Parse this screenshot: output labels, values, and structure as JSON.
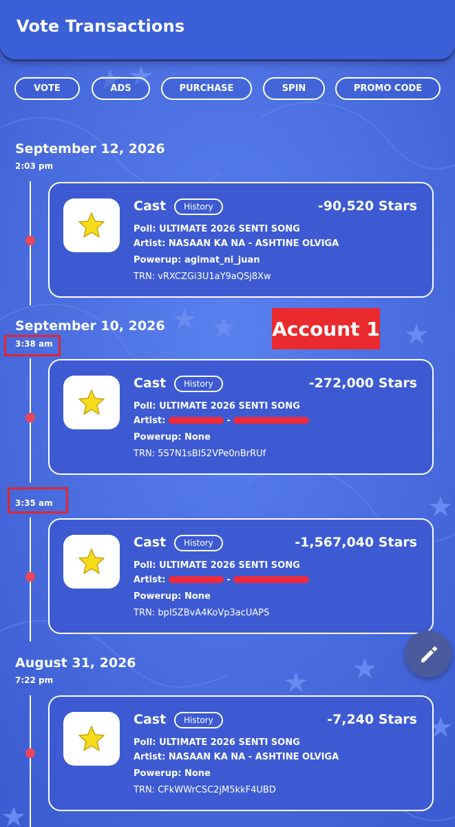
{
  "header": {
    "title": "Vote Transactions"
  },
  "tabs": [
    "VOTE",
    "ADS",
    "PURCHASE",
    "SPIN",
    "PROMO CODE"
  ],
  "annotation": {
    "label": "Account 1"
  },
  "groups": [
    {
      "date": "September 12, 2026"
    },
    {
      "date": "September 10, 2026"
    },
    {
      "date": "August 31, 2026"
    }
  ],
  "transactions": [
    {
      "time": "2:03 pm",
      "type": "Cast",
      "history_label": "History",
      "amount": "-90,520 Stars",
      "poll": "Poll: ULTIMATE 2026 SENTI SONG",
      "artist": "Artist: NASAAN KA NA - ASHTINE OLVIGA",
      "powerup": "Powerup: agimat_ni_juan",
      "trn": "TRN: vRXCZGi3U1aY9aQSj8Xw"
    },
    {
      "time": "3:38 am",
      "type": "Cast",
      "history_label": "History",
      "amount": "-272,000 Stars",
      "poll": "Poll: ULTIMATE 2026 SENTI SONG",
      "artist_prefix": "Artist:",
      "artist_sep": "-",
      "powerup": "Powerup: None",
      "trn": "TRN: 5S7N1sBI52VPe0nBrRUf"
    },
    {
      "time": "3:35 am",
      "type": "Cast",
      "history_label": "History",
      "amount": "-1,567,040 Stars",
      "poll": "Poll: ULTIMATE 2026 SENTI SONG",
      "artist_prefix": "Artist:",
      "artist_sep": "-",
      "powerup": "Powerup: None",
      "trn": "TRN: bpISZBvA4KoVp3acUAPS"
    },
    {
      "time": "7:22 pm",
      "type": "Cast",
      "history_label": "History",
      "amount": "-7,240 Stars",
      "poll": "Poll: ULTIMATE 2026 SENTI SONG",
      "artist": "Artist: NASAAN KA NA - ASHTINE OLVIGA",
      "powerup": "Powerup: None",
      "trn": "TRN: CFkWWrCSC2jM5kkF4UBD"
    }
  ],
  "colors": {
    "background": "#3f64d8",
    "card": "#3d5ad3",
    "timeline_dot": "#e8475a",
    "annotation_red": "#ea2a2e",
    "star": "#f7dc1c"
  },
  "icons": {
    "card_icon": "star-icon",
    "fab_icon": "pencil-icon"
  }
}
